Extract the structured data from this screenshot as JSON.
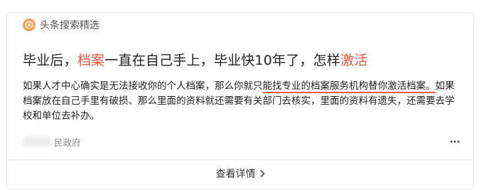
{
  "source": {
    "label": "头条搜索精选",
    "icon": "toutiao-search-logo-icon"
  },
  "title": {
    "part1": "毕业后，",
    "hl1": "档案",
    "part2": "一直在自己手上，毕业快10年了，怎样",
    "hl2": "激活"
  },
  "snippet": {
    "part1": "如果人才中心确实是无法接收你的个人档案，那么你就只",
    "underlined": "能找专业的档案服务机构替你激活档案。",
    "part2": "如果档案放在自己手里有破损、那么里面的资料就还需要有关部门去核实，里面的资料有遗失，还需要去学校和单位去补办。"
  },
  "meta": {
    "source_text": "民政府",
    "more_icon": "more-dots-icon"
  },
  "footer": {
    "detail_label": "查看详情",
    "chevron_icon": "chevron-right-icon"
  },
  "colors": {
    "highlight": "#f0553c",
    "underline": "#f25c3c",
    "logo": "#f4a25c"
  }
}
